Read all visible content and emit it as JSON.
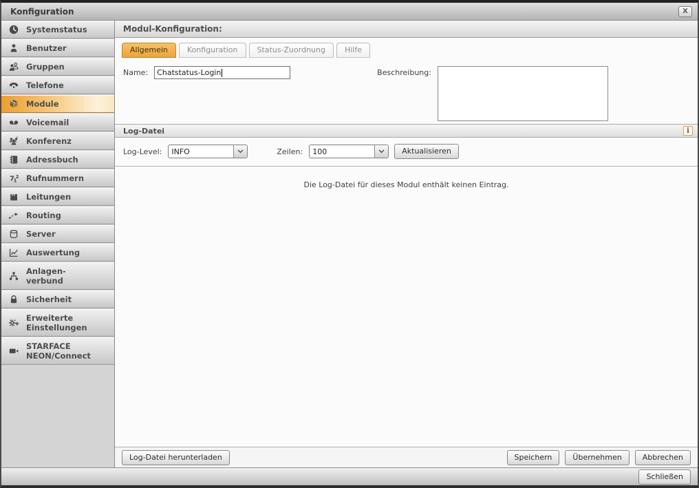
{
  "window": {
    "title": "Konfiguration",
    "close_glyph": "X"
  },
  "sidebar": {
    "items": [
      {
        "label": "Systemstatus",
        "icon": "clock-icon"
      },
      {
        "label": "Benutzer",
        "icon": "user-icon"
      },
      {
        "label": "Gruppen",
        "icon": "users-icon"
      },
      {
        "label": "Telefone",
        "icon": "phone-icon"
      },
      {
        "label": "Module",
        "icon": "cube-icon",
        "active": true
      },
      {
        "label": "Voicemail",
        "icon": "voicemail-icon"
      },
      {
        "label": "Konferenz",
        "icon": "conference-icon"
      },
      {
        "label": "Adressbuch",
        "icon": "address-book-icon"
      },
      {
        "label": "Rufnummern",
        "icon": "numbers-icon"
      },
      {
        "label": "Leitungen",
        "icon": "plug-icon"
      },
      {
        "label": "Routing",
        "icon": "routing-icon"
      },
      {
        "label": "Server",
        "icon": "server-icon"
      },
      {
        "label": "Auswertung",
        "icon": "chart-icon"
      },
      {
        "label": "Anlagen-",
        "label2": "verbund",
        "icon": "network-icon"
      },
      {
        "label": "Sicherheit",
        "icon": "lock-icon"
      },
      {
        "label": "Erweiterte",
        "label2": "Einstellungen",
        "icon": "gear-plus-icon"
      },
      {
        "label": "STARFACE",
        "label2": "NEON/Connect",
        "icon": "camera-icon"
      }
    ]
  },
  "main": {
    "header": "Modul-Konfiguration:",
    "tabs": {
      "allgemein": "Allgemein",
      "konfiguration": "Konfiguration",
      "status_zuordnung": "Status-Zuordnung",
      "hilfe": "Hilfe"
    },
    "form": {
      "name_label": "Name:",
      "name_value": "Chatstatus-Login",
      "beschreibung_label": "Beschreibung:",
      "beschreibung_value": ""
    },
    "log": {
      "title": "Log-Datei",
      "info_glyph": "i",
      "level_label": "Log-Level:",
      "level_value": "INFO",
      "zeilen_label": "Zeilen:",
      "zeilen_value": "100",
      "refresh_label": "Aktualisieren",
      "empty_message": "Die Log-Datei für dieses Modul enthält keinen Eintrag."
    },
    "footer": {
      "download_label": "Log-Datei herunterladen",
      "save_label": "Speichern",
      "apply_label": "Übernehmen",
      "cancel_label": "Abbrechen"
    }
  },
  "bottom_bar": {
    "close_label": "Schließen"
  },
  "colors": {
    "accent_orange": "#eda43c",
    "active_tab_border": "#b9862e",
    "sidebar_active_orange": "#ec9f2e",
    "chrome_gray": "#c7c7c7",
    "text_dark": "#4a4a4a"
  }
}
